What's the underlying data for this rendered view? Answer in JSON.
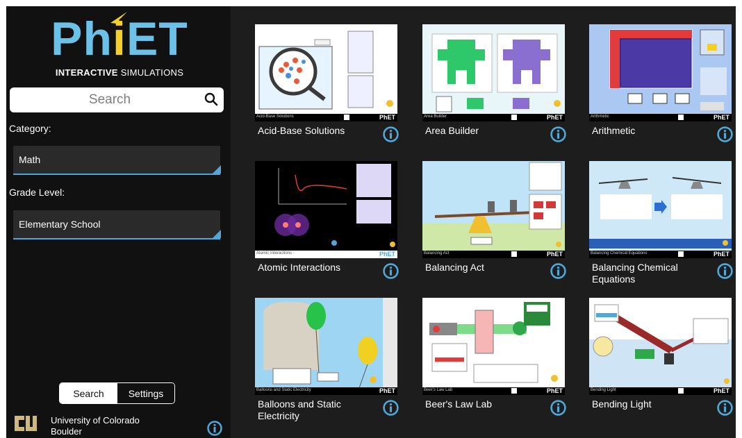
{
  "brand": {
    "logo_text": "PhET",
    "subtitle_bold": "INTERACTIVE",
    "subtitle_rest": " SIMULATIONS",
    "logo_colors": {
      "blue": "#6cc1e9",
      "yellow": "#f3cf28"
    }
  },
  "search": {
    "placeholder": "Search",
    "icon": "magnifier-icon"
  },
  "filters": {
    "category_label": "Category:",
    "category_value": "Math",
    "grade_label": "Grade Level:",
    "grade_value": "Elementary School"
  },
  "bottom_tabs": {
    "search_label": "Search",
    "settings_label": "Settings",
    "active": "Search"
  },
  "footer": {
    "university": "University of Colorado Boulder",
    "icon": "info-icon"
  },
  "theme": {
    "accent": "#4fa8d8",
    "background": "#1d1d1d",
    "sidebar": "#111111"
  },
  "simulations": [
    {
      "title": "Acid-Base Solutions",
      "thumb_label": "Acid-Base Solutions",
      "brand": "PhET"
    },
    {
      "title": "Area Builder",
      "thumb_label": "Area Builder",
      "brand": "PhET"
    },
    {
      "title": "Arithmetic",
      "thumb_label": "Arithmetic",
      "brand": "PhET"
    },
    {
      "title": "Atomic Interactions",
      "thumb_label": "Atomic Interactions",
      "brand": "PhET"
    },
    {
      "title": "Balancing Act",
      "thumb_label": "Balancing Act",
      "brand": "PhET"
    },
    {
      "title": "Balancing Chemical Equations",
      "thumb_label": "Balancing Chemical Equations",
      "brand": "PhET"
    },
    {
      "title": "Balloons and Static Electricity",
      "thumb_label": "Balloons and Static Electricity",
      "brand": "PhET"
    },
    {
      "title": "Beer's Law Lab",
      "thumb_label": "Beer's Law Lab",
      "brand": "PhET"
    },
    {
      "title": "Bending Light",
      "thumb_label": "Bending Light",
      "brand": "PhET"
    }
  ]
}
